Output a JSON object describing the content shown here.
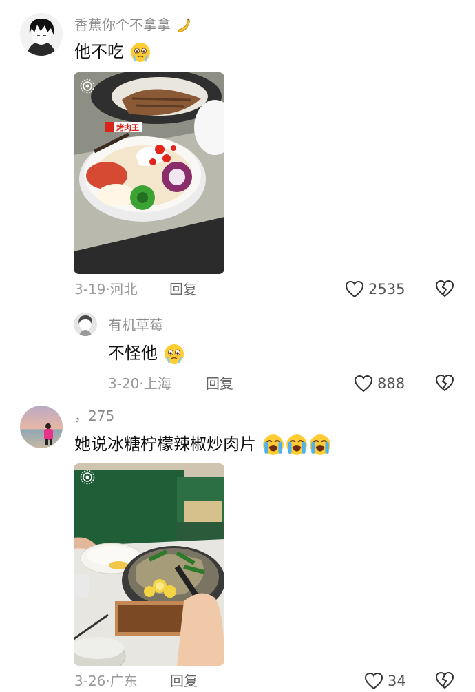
{
  "comments": [
    {
      "username": "香蕉你个不拿拿",
      "username_emoji": "banana-icon",
      "text": "他不吃",
      "text_emoji": [
        "crying-face-emoji"
      ],
      "date": "3-19",
      "location": "河北",
      "reply_label": "回复",
      "likes": "2535",
      "replies": [
        {
          "username": "有机草莓",
          "text": "不怪他",
          "text_emoji": [
            "crying-face-emoji"
          ],
          "date": "3-20",
          "location": "上海",
          "reply_label": "回复",
          "likes": "888"
        }
      ]
    },
    {
      "username": "，275",
      "text": "她说冰糖柠檬辣椒炒肉片",
      "text_emoji": [
        "loudly-crying-emoji",
        "loudly-crying-emoji",
        "loudly-crying-emoji"
      ],
      "date": "3-26",
      "location": "广东",
      "reply_label": "回复",
      "likes": "34"
    }
  ],
  "bowl_brand": "烤肉王",
  "colors": {
    "name_gray": "#8a8a8a",
    "text_black": "#111111",
    "meta_gray": "#9a9a9a"
  }
}
